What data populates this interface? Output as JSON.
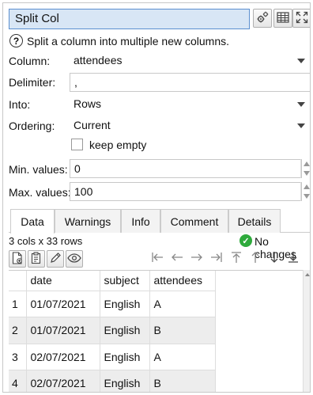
{
  "window": {
    "title": "Split Col",
    "toolbar_icons": [
      "gear-icon",
      "table-icon",
      "expand-icon"
    ]
  },
  "description": "Split a column into multiple new columns.",
  "form": {
    "column_label": "Column:",
    "column_value": "attendees",
    "delimiter_label": "Delimiter:",
    "delimiter_value": ",",
    "into_label": "Into:",
    "into_value": "Rows",
    "ordering_label": "Ordering:",
    "ordering_value": "Current",
    "keep_empty_label": "keep empty",
    "keep_empty_checked": false,
    "min_values_label": "Min. values:",
    "min_values_value": "0",
    "max_values_label": "Max. values:",
    "max_values_value": "100"
  },
  "tabs": [
    {
      "label": "Data",
      "active": true
    },
    {
      "label": "Warnings",
      "active": false
    },
    {
      "label": "Info",
      "active": false
    },
    {
      "label": "Comment",
      "active": false
    },
    {
      "label": "Details",
      "active": false
    }
  ],
  "status": {
    "shape": "3 cols x 33 rows",
    "changes": "No changes",
    "changes_color": "#2eaa3c"
  },
  "data_toolbar": {
    "left_icons": [
      "new-document-icon",
      "paste-icon",
      "pencil-icon",
      "eye-icon"
    ],
    "nav_icons": [
      "first-column-icon",
      "left-arrow-icon",
      "right-arrow-icon",
      "last-column-icon",
      "top-icon",
      "up-arrow-icon",
      "down-arrow-icon",
      "bottom-icon"
    ]
  },
  "table": {
    "columns": [
      "date",
      "subject",
      "attendees"
    ],
    "rows": [
      {
        "n": "1",
        "date": "01/07/2021",
        "subject": "English",
        "attendees": "A"
      },
      {
        "n": "2",
        "date": "01/07/2021",
        "subject": "English",
        "attendees": "B"
      },
      {
        "n": "3",
        "date": "02/07/2021",
        "subject": "English",
        "attendees": "A"
      },
      {
        "n": "4",
        "date": "02/07/2021",
        "subject": "English",
        "attendees": "B"
      }
    ]
  }
}
